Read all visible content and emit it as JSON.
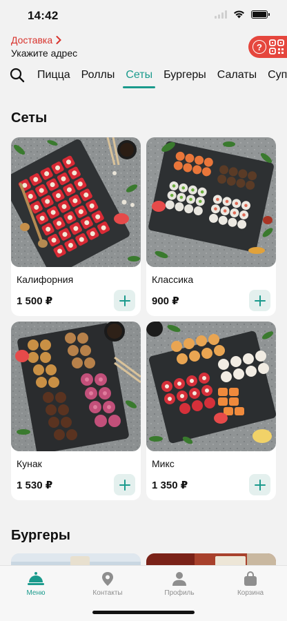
{
  "status_bar": {
    "time": "14:42"
  },
  "header": {
    "delivery_label": "Доставка",
    "address_prompt": "Укажите адрес"
  },
  "categories": {
    "tabs": [
      {
        "label": "Пицца"
      },
      {
        "label": "Роллы"
      },
      {
        "label": "Сеты"
      },
      {
        "label": "Бургеры"
      },
      {
        "label": "Салаты"
      },
      {
        "label": "Суп"
      }
    ],
    "active_tab": "Сеты"
  },
  "sections": {
    "sets": {
      "title": "Сеты",
      "items": [
        {
          "name": "Калифорния",
          "price": "1 500 ₽"
        },
        {
          "name": "Классика",
          "price": "900 ₽"
        },
        {
          "name": "Кунак",
          "price": "1 530 ₽"
        },
        {
          "name": "Микс",
          "price": "1 350 ₽"
        }
      ]
    },
    "burgers": {
      "title": "Бургеры"
    }
  },
  "bottom_nav": {
    "items": [
      {
        "label": "Меню",
        "icon": "food-dome-icon",
        "active": true
      },
      {
        "label": "Контакты",
        "icon": "location-pin-icon"
      },
      {
        "label": "Профиль",
        "icon": "user-icon"
      },
      {
        "label": "Корзина",
        "icon": "shopping-bag-icon"
      }
    ]
  },
  "colors": {
    "accent": "#1a9a8c",
    "delivery_red": "#d8322c",
    "pill_red": "#e5463d",
    "background": "#f2f2f2"
  }
}
